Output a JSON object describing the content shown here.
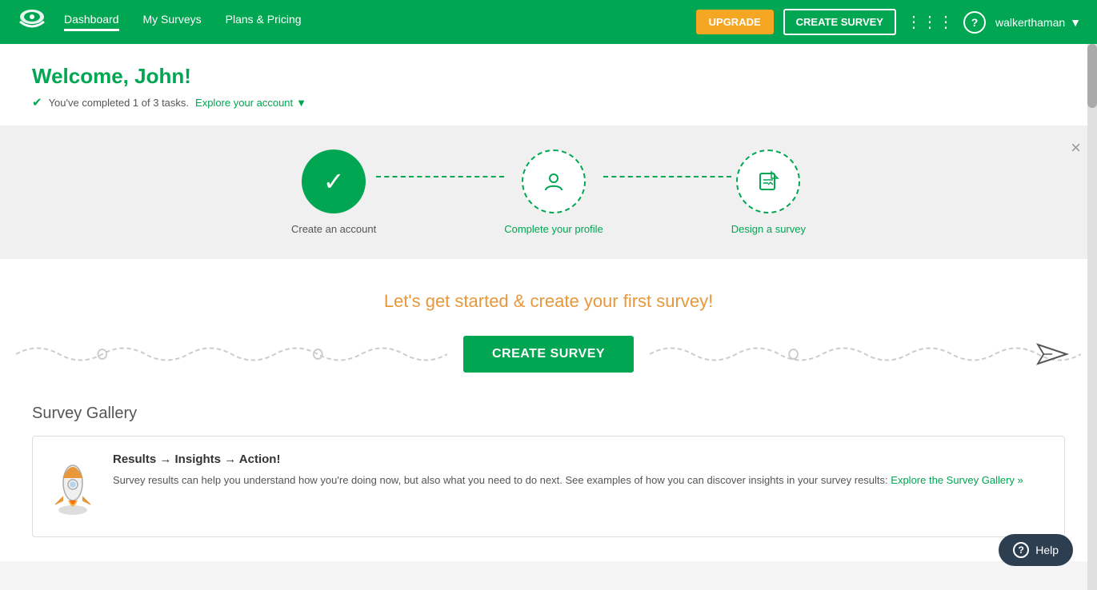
{
  "nav": {
    "logo_alt": "SurveyMonkey",
    "links": [
      {
        "label": "Dashboard",
        "active": true
      },
      {
        "label": "My Surveys",
        "active": false
      },
      {
        "label": "Plans & Pricing",
        "active": false
      }
    ],
    "upgrade_label": "UPGRADE",
    "create_survey_label": "CREATE SURVEY",
    "user_name": "walkerthaman",
    "chevron": "▼"
  },
  "welcome": {
    "greeting_prefix": "Welcome, ",
    "user_first_name": "John!",
    "tasks_text": "You've completed 1 of 3 tasks.",
    "explore_link": "Explore your account",
    "chevron": "▼"
  },
  "steps": [
    {
      "label": "Create an account",
      "status": "done"
    },
    {
      "label": "Complete your profile",
      "status": "active"
    },
    {
      "label": "Design a survey",
      "status": "active"
    }
  ],
  "close_btn": "×",
  "cta": {
    "title": "Let's get started & create your first survey!",
    "button_label": "CREATE SURVEY"
  },
  "gallery": {
    "title": "Survey Gallery",
    "card": {
      "title": "Results → Insights → Action!",
      "description": "Survey results can help you understand how you're doing now, but also what you need to do next. See examples of how you can discover insights in your survey results:",
      "link_text": "Explore the Survey Gallery »"
    }
  },
  "help": {
    "label": "Help",
    "icon": "?"
  },
  "icons": {
    "check": "✓",
    "grid": "⠿",
    "question": "?",
    "profile": "👤",
    "edit": "✎",
    "plane": "✈"
  }
}
